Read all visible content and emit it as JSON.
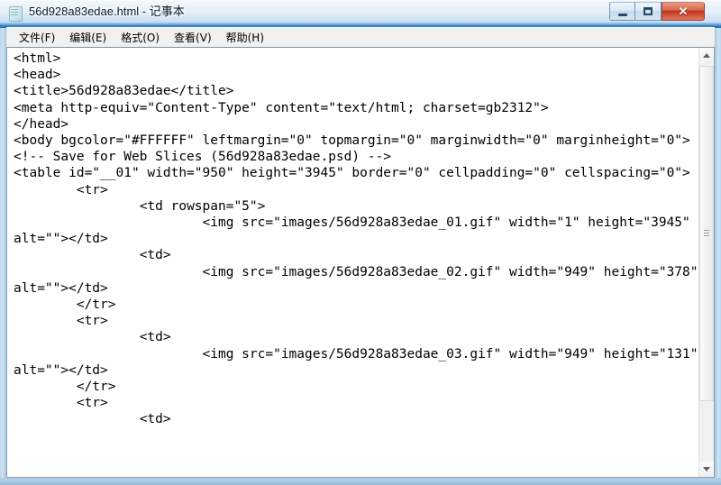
{
  "window": {
    "title": "56d928a83edae.html - 记事本",
    "icon": "notepad-document-icon",
    "buttons": {
      "minimize": "minimize-icon",
      "maximize": "maximize-icon",
      "close": "✕"
    },
    "accent_title_strip": "#2f7fc4",
    "close_button_color": "#c0331a"
  },
  "menubar": {
    "items": [
      {
        "label": "文件(F)",
        "name": "menu-file"
      },
      {
        "label": "编辑(E)",
        "name": "menu-edit"
      },
      {
        "label": "格式(O)",
        "name": "menu-format"
      },
      {
        "label": "查看(V)",
        "name": "menu-view"
      },
      {
        "label": "帮助(H)",
        "name": "menu-help"
      }
    ]
  },
  "editor": {
    "content": "<html>\n<head>\n<title>56d928a83edae</title>\n<meta http-equiv=\"Content-Type\" content=\"text/html; charset=gb2312\">\n</head>\n<body bgcolor=\"#FFFFFF\" leftmargin=\"0\" topmargin=\"0\" marginwidth=\"0\" marginheight=\"0\">\n<!-- Save for Web Slices (56d928a83edae.psd) -->\n<table id=\"__01\" width=\"950\" height=\"3945\" border=\"0\" cellpadding=\"0\" cellspacing=\"0\">\n\t<tr>\n\t\t<td rowspan=\"5\">\n\t\t\t<img src=\"images/56d928a83edae_01.gif\" width=\"1\" height=\"3945\" alt=\"\"></td>\n\t\t<td>\n\t\t\t<img src=\"images/56d928a83edae_02.gif\" width=\"949\" height=\"378\" alt=\"\"></td>\n\t</tr>\n\t<tr>\n\t\t<td>\n\t\t\t<img src=\"images/56d928a83edae_03.gif\" width=\"949\" height=\"131\" alt=\"\"></td>\n\t</tr>\n\t<tr>\n\t\t<td>",
    "background": "#FFFFFF",
    "foreground": "#000000"
  },
  "scrollbar": {
    "up_arrow": "scroll-up-icon",
    "down_arrow": "scroll-down-icon",
    "thumb": "scroll-thumb"
  }
}
